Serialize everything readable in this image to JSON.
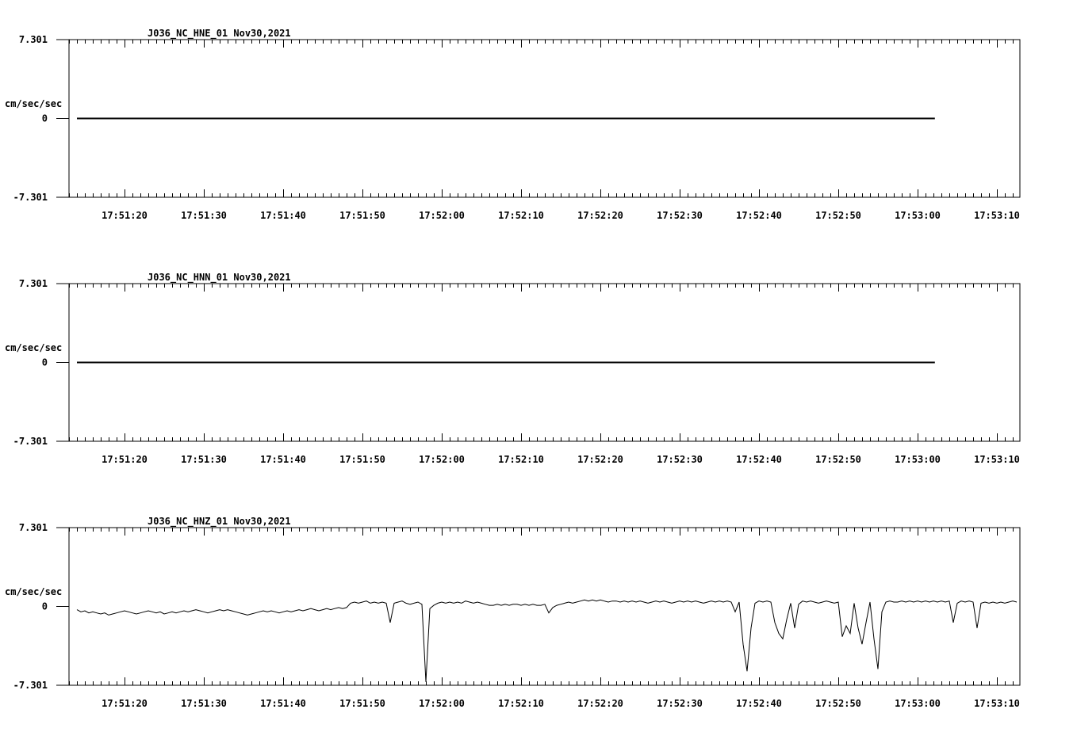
{
  "colors": {
    "background": "#ffffff",
    "ink": "#000000"
  },
  "chart_data": [
    {
      "type": "line",
      "title": "J036_NC_HNE_01   Nov30,2021",
      "ylabel": "cm/sec/sec",
      "ylim": [
        -7.301,
        7.301
      ],
      "ytick_labels": [
        "7.301",
        "0",
        "-7.301"
      ],
      "x_tick_labels": [
        "17:51:20",
        "17:51:30",
        "17:51:40",
        "17:51:50",
        "17:52:00",
        "17:52:10",
        "17:52:20",
        "17:52:30",
        "17:52:40",
        "17:52:50",
        "17:53:00",
        "17:53:10"
      ],
      "grid": false,
      "series": [
        {
          "x_start": "17:51:14",
          "x_end": "17:53:13",
          "values": [
            0,
            0,
            0,
            0,
            0,
            0,
            0,
            0,
            0,
            0,
            0,
            0
          ]
        }
      ]
    },
    {
      "type": "line",
      "title": "J036_NC_HNN_01   Nov30,2021",
      "ylabel": "cm/sec/sec",
      "ylim": [
        -7.301,
        7.301
      ],
      "ytick_labels": [
        "7.301",
        "0",
        "-7.301"
      ],
      "x_tick_labels": [
        "17:51:20",
        "17:51:30",
        "17:51:40",
        "17:51:50",
        "17:52:00",
        "17:52:10",
        "17:52:20",
        "17:52:30",
        "17:52:40",
        "17:52:50",
        "17:53:00",
        "17:53:10"
      ],
      "grid": false,
      "series": [
        {
          "x_start": "17:51:14",
          "x_end": "17:53:13",
          "values": [
            0,
            0,
            0,
            0,
            0,
            0,
            0,
            0,
            0,
            0,
            0,
            0
          ]
        }
      ]
    },
    {
      "type": "line",
      "title": "J036_NC_HNZ_01   Nov30,2021",
      "ylabel": "cm/sec/sec",
      "ylim": [
        -7.301,
        7.301
      ],
      "ytick_labels": [
        "7.301",
        "0",
        "-7.301"
      ],
      "x_tick_labels": [
        "17:51:20",
        "17:51:30",
        "17:51:40",
        "17:51:50",
        "17:52:00",
        "17:52:10",
        "17:52:20",
        "17:52:30",
        "17:52:40",
        "17:52:50",
        "17:53:00",
        "17:53:10"
      ],
      "grid": false,
      "series": [
        {
          "x_start": "17:51:14",
          "x_end": "17:53:13",
          "step_seconds": 0.5,
          "values": [
            -0.3,
            -0.5,
            -0.4,
            -0.6,
            -0.5,
            -0.6,
            -0.7,
            -0.6,
            -0.8,
            -0.7,
            -0.6,
            -0.5,
            -0.4,
            -0.5,
            -0.6,
            -0.7,
            -0.6,
            -0.5,
            -0.4,
            -0.5,
            -0.6,
            -0.5,
            -0.7,
            -0.6,
            -0.5,
            -0.6,
            -0.5,
            -0.4,
            -0.5,
            -0.4,
            -0.3,
            -0.4,
            -0.5,
            -0.6,
            -0.5,
            -0.4,
            -0.3,
            -0.4,
            -0.3,
            -0.4,
            -0.5,
            -0.6,
            -0.7,
            -0.8,
            -0.7,
            -0.6,
            -0.5,
            -0.4,
            -0.5,
            -0.4,
            -0.5,
            -0.6,
            -0.5,
            -0.4,
            -0.5,
            -0.4,
            -0.3,
            -0.4,
            -0.3,
            -0.2,
            -0.3,
            -0.4,
            -0.3,
            -0.2,
            -0.3,
            -0.2,
            -0.1,
            -0.2,
            -0.1,
            0.3,
            0.4,
            0.3,
            0.4,
            0.5,
            0.3,
            0.4,
            0.3,
            0.4,
            0.3,
            -1.5,
            0.3,
            0.4,
            0.5,
            0.3,
            0.2,
            0.3,
            0.4,
            0.2,
            -7.0,
            -0.2,
            0.1,
            0.3,
            0.4,
            0.3,
            0.4,
            0.3,
            0.4,
            0.3,
            0.5,
            0.4,
            0.3,
            0.4,
            0.3,
            0.2,
            0.1,
            0.1,
            0.2,
            0.1,
            0.2,
            0.1,
            0.2,
            0.2,
            0.1,
            0.2,
            0.1,
            0.2,
            0.1,
            0.1,
            0.2,
            -0.6,
            -0.1,
            0.1,
            0.2,
            0.3,
            0.4,
            0.3,
            0.4,
            0.5,
            0.6,
            0.5,
            0.6,
            0.5,
            0.6,
            0.5,
            0.4,
            0.5,
            0.5,
            0.4,
            0.5,
            0.4,
            0.5,
            0.4,
            0.5,
            0.4,
            0.3,
            0.4,
            0.5,
            0.4,
            0.5,
            0.4,
            0.3,
            0.4,
            0.5,
            0.4,
            0.5,
            0.4,
            0.5,
            0.4,
            0.3,
            0.4,
            0.5,
            0.4,
            0.5,
            0.4,
            0.5,
            0.4,
            -0.5,
            0.4,
            -3.5,
            -6.0,
            -2.0,
            0.3,
            0.5,
            0.4,
            0.5,
            0.4,
            -1.5,
            -2.5,
            -3.0,
            -1.2,
            0.3,
            -2.0,
            0.2,
            0.5,
            0.4,
            0.5,
            0.4,
            0.3,
            0.4,
            0.5,
            0.4,
            0.3,
            0.4,
            -2.8,
            -1.8,
            -2.5,
            0.3,
            -2.0,
            -3.5,
            -1.5,
            0.4,
            -3.0,
            -5.8,
            -0.5,
            0.4,
            0.5,
            0.4,
            0.4,
            0.5,
            0.4,
            0.5,
            0.4,
            0.5,
            0.4,
            0.5,
            0.4,
            0.5,
            0.4,
            0.5,
            0.4,
            0.5,
            -1.5,
            0.3,
            0.5,
            0.4,
            0.5,
            0.4,
            -2.0,
            0.3,
            0.4,
            0.3,
            0.4,
            0.3,
            0.4,
            0.3,
            0.4,
            0.5,
            0.4,
            0.5,
            0.4,
            0.3,
            0.4,
            0.3,
            0.4,
            0.3,
            0.4,
            0.3,
            0.4,
            0.3,
            0.4,
            0.5
          ]
        }
      ]
    }
  ]
}
